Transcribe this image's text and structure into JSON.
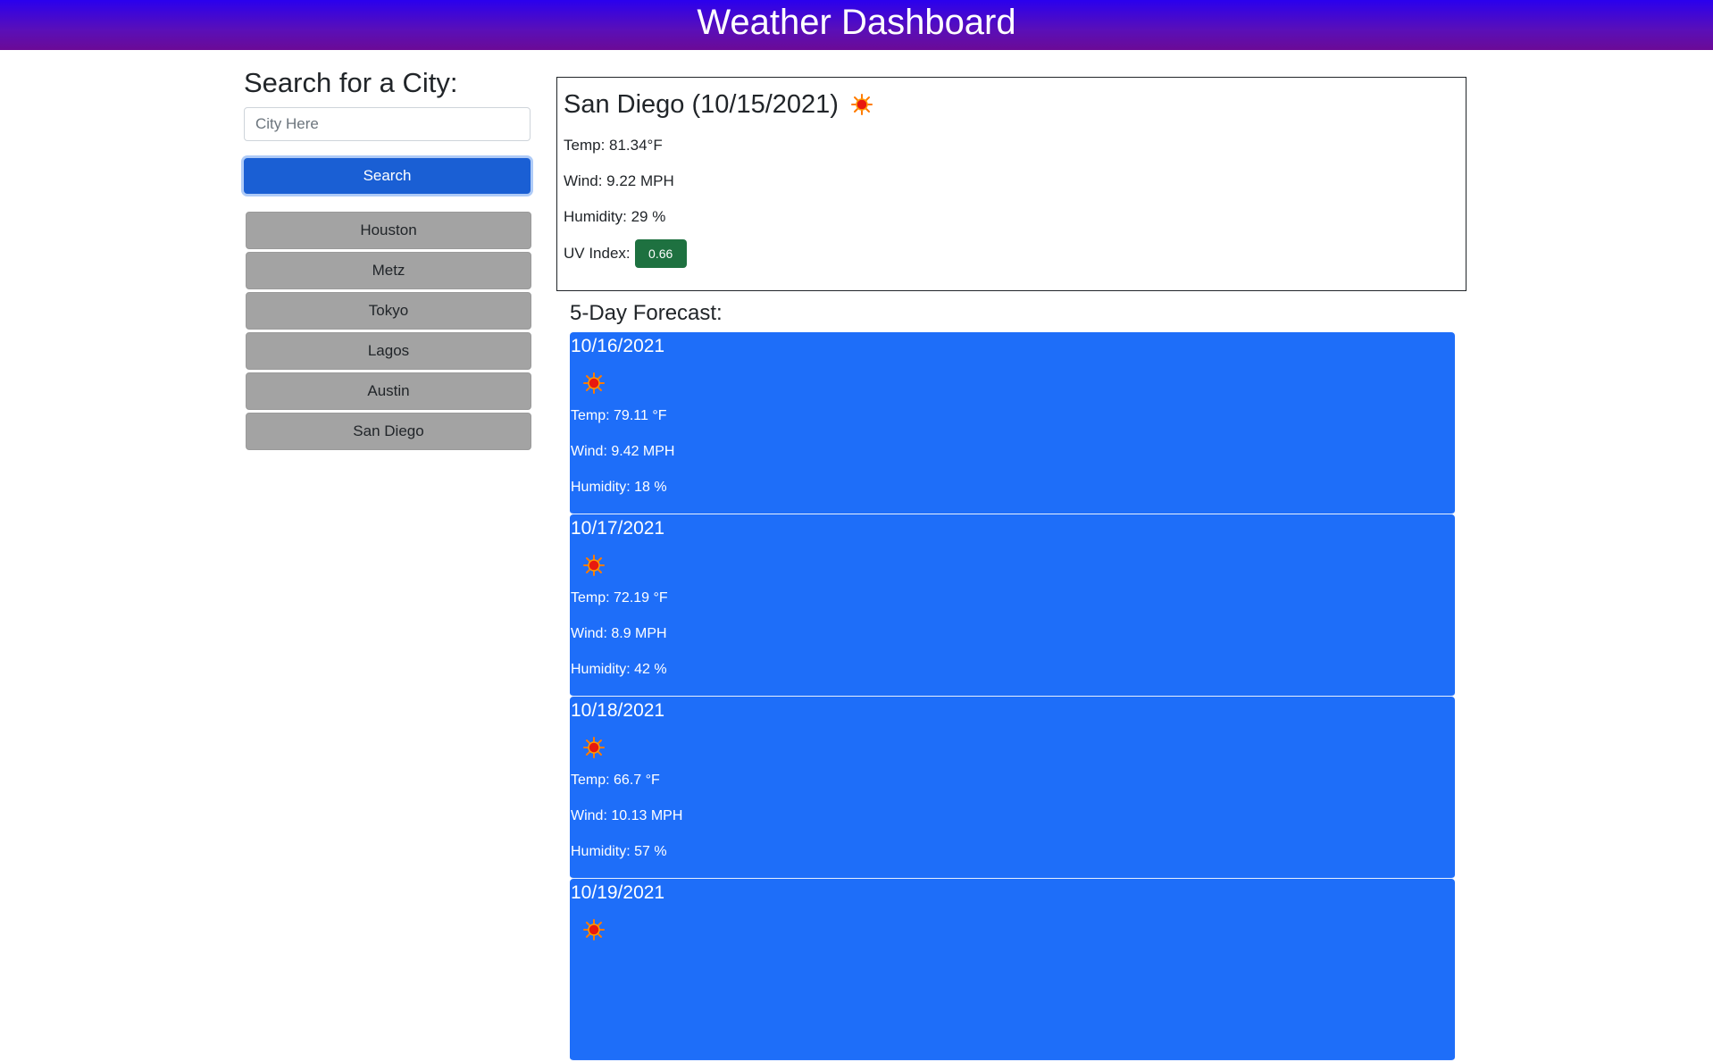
{
  "header": {
    "title": "Weather Dashboard"
  },
  "sidebar": {
    "heading": "Search for a City:",
    "search_placeholder": "City Here",
    "search_value": "",
    "search_button_label": "Search",
    "history": [
      {
        "label": "Houston"
      },
      {
        "label": "Metz"
      },
      {
        "label": "Tokyo"
      },
      {
        "label": "Lagos"
      },
      {
        "label": "Austin"
      },
      {
        "label": "San Diego"
      }
    ]
  },
  "current": {
    "title": "San Diego (10/15/2021)",
    "icon": "sun-icon",
    "temp": "Temp: 81.34°F",
    "wind": "Wind: 9.22 MPH",
    "humidity": "Humidity: 29 %",
    "uv_label": "UV Index:",
    "uv_value": "0.66",
    "uv_color": "#1e7140"
  },
  "forecast": {
    "heading": "5-Day Forecast:",
    "days": [
      {
        "date": "10/16/2021",
        "icon": "sun-icon",
        "temp": "Temp: 79.11 °F",
        "wind": "Wind: 9.42 MPH",
        "humidity": "Humidity: 18 %"
      },
      {
        "date": "10/17/2021",
        "icon": "sun-icon",
        "temp": "Temp: 72.19 °F",
        "wind": "Wind: 8.9 MPH",
        "humidity": "Humidity: 42 %"
      },
      {
        "date": "10/18/2021",
        "icon": "sun-icon",
        "temp": "Temp: 66.7 °F",
        "wind": "Wind: 10.13 MPH",
        "humidity": "Humidity: 57 %"
      },
      {
        "date": "10/19/2021",
        "icon": "sun-icon",
        "temp": "",
        "wind": "",
        "humidity": ""
      }
    ]
  },
  "colors": {
    "header_gradient_top": "#2a00ee",
    "header_gradient_bottom": "#6b0a96",
    "search_button": "#1a5fd4",
    "history_button": "#a3a3a3",
    "forecast_card": "#1e6ef9"
  }
}
